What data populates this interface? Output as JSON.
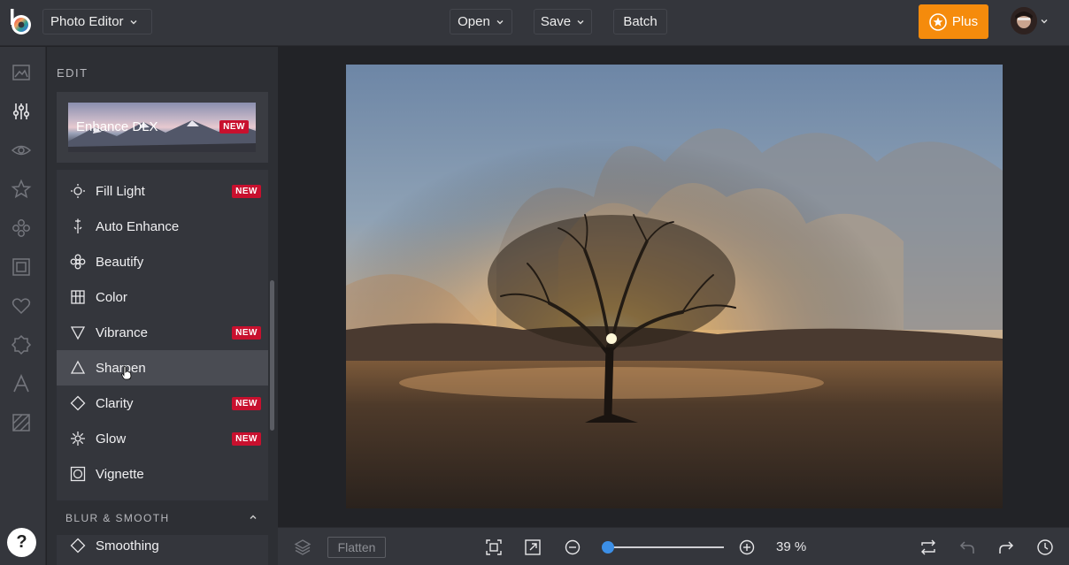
{
  "app": {
    "selector_label": "Photo Editor"
  },
  "topbar": {
    "open_label": "Open",
    "save_label": "Save",
    "batch_label": "Batch",
    "plus_label": "Plus"
  },
  "rail": {
    "icons": [
      "image-icon",
      "sliders-icon",
      "eye-icon",
      "star-icon",
      "overlay-icon",
      "frame-icon",
      "heart-icon",
      "badge-icon",
      "text-icon",
      "texture-icon"
    ],
    "active": "sliders-icon"
  },
  "panel": {
    "section_title": "EDIT",
    "enhance": {
      "label": "Enhance DLX",
      "badge": "NEW"
    },
    "items": [
      {
        "label": "Fill Light",
        "icon": "sun-icon",
        "badge": "NEW"
      },
      {
        "label": "Auto Enhance",
        "icon": "wand-icon",
        "badge": ""
      },
      {
        "label": "Beautify",
        "icon": "flower-icon",
        "badge": ""
      },
      {
        "label": "Color",
        "icon": "color-bars-icon",
        "badge": ""
      },
      {
        "label": "Vibrance",
        "icon": "triangle-down-icon",
        "badge": "NEW"
      },
      {
        "label": "Sharpen",
        "icon": "triangle-up-icon",
        "badge": "",
        "active": true
      },
      {
        "label": "Clarity",
        "icon": "diamond-icon",
        "badge": "NEW"
      },
      {
        "label": "Glow",
        "icon": "sparkle-icon",
        "badge": "NEW"
      },
      {
        "label": "Vignette",
        "icon": "vignette-icon",
        "badge": ""
      }
    ],
    "blur_section_title": "BLUR & SMOOTH",
    "blur_items": [
      {
        "label": "Smoothing",
        "icon": "diamond-icon"
      }
    ]
  },
  "bottombar": {
    "flatten_label": "Flatten",
    "zoom_percent": 39,
    "zoom_text": "39 %"
  },
  "colors": {
    "accent": "#f58b0c",
    "badge": "#c8102e",
    "slider": "#3c8fe6"
  },
  "help_label": "?"
}
